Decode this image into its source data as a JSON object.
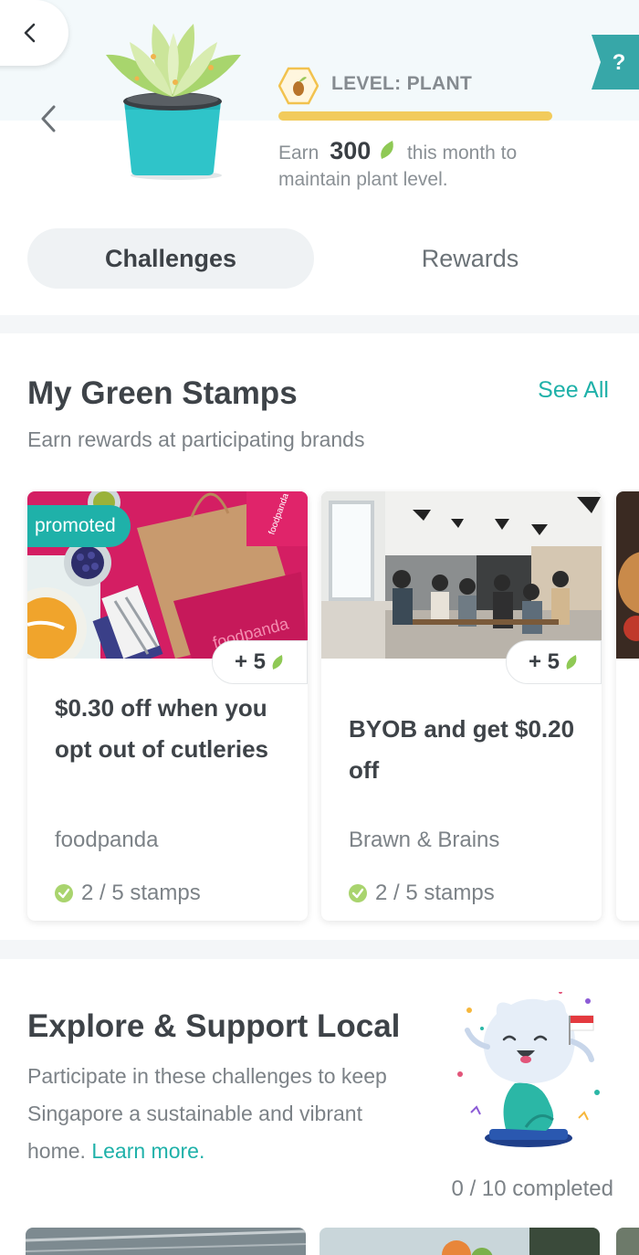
{
  "header": {
    "level_label": "LEVEL: PLANT",
    "level_progress": 1.0,
    "earn_prefix": "Earn",
    "earn_points": "300",
    "earn_suffix": "this month to",
    "earn_line2": "maintain plant level.",
    "help_label": "?"
  },
  "tabs": [
    {
      "label": "Challenges",
      "active": true
    },
    {
      "label": "Rewards",
      "active": false
    }
  ],
  "stamps": {
    "title": "My Green Stamps",
    "subtitle": "Earn rewards at participating brands",
    "see_all": "See All",
    "cards": [
      {
        "tag": "promoted",
        "points": "+ 5",
        "title": "$0.30 off when you opt out of cutleries",
        "brand": "foodpanda",
        "stamps": "2 / 5 stamps",
        "image_text": "foodpanda"
      },
      {
        "points": "+ 5",
        "title": "BYOB and get $0.20 off",
        "brand": "Brawn & Brains",
        "stamps": "2 / 5 stamps"
      }
    ]
  },
  "explore": {
    "title": "Explore & Support Local",
    "description": "Participate in these challenges to keep Singapore a sustainable and vibrant home.",
    "learn_more": "Learn more.",
    "completed": "0 / 10 completed"
  },
  "colors": {
    "accent": "#1fb1a9",
    "level_bar": "#f2cb5c",
    "foodpanda_pink": "#d7195b"
  },
  "icons": [
    "back-arrow-icon",
    "help-icon",
    "plant-pot-icon",
    "seed-badge-icon",
    "leaf-icon",
    "check-circle-icon",
    "merlion-mascot-icon"
  ]
}
